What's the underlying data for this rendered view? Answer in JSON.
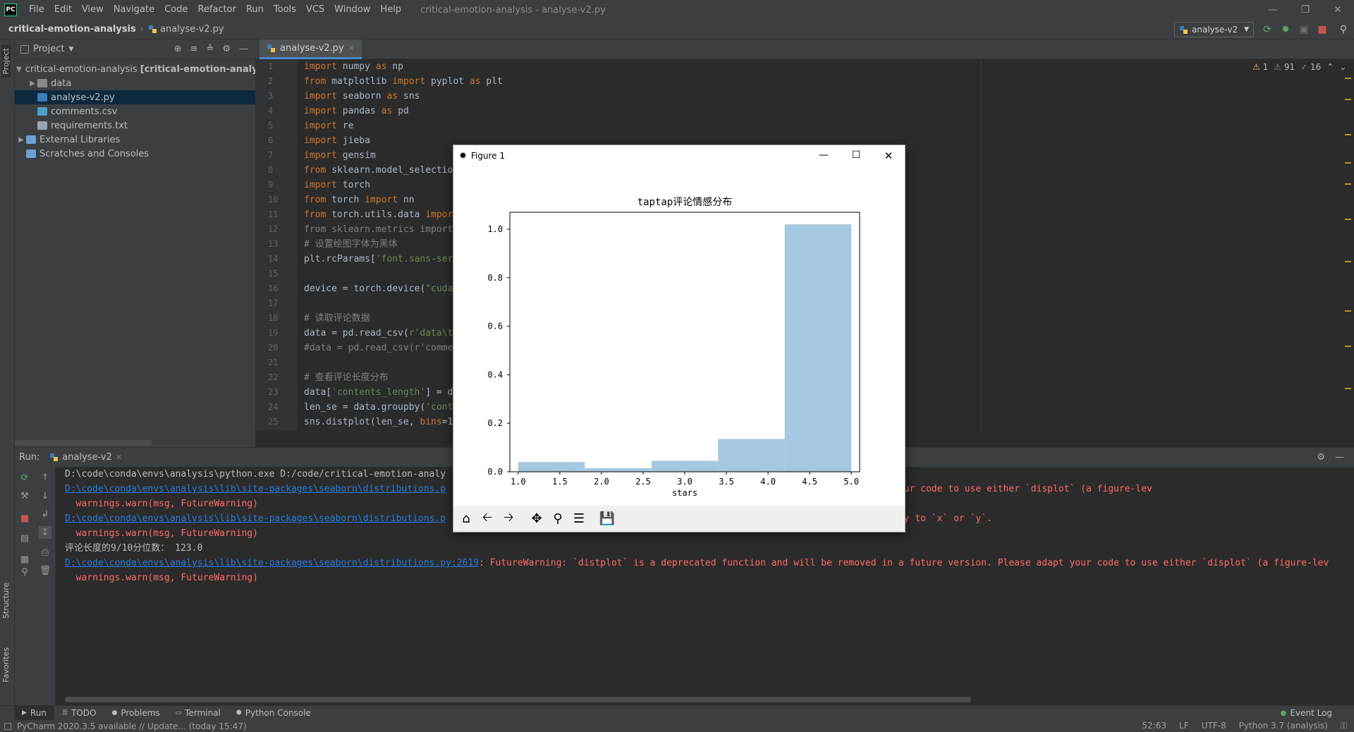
{
  "app": {
    "logo": "PC",
    "menu": [
      "File",
      "Edit",
      "View",
      "Navigate",
      "Code",
      "Refactor",
      "Run",
      "Tools",
      "VCS",
      "Window",
      "Help"
    ],
    "window_title": "critical-emotion-analysis - analyse-v2.py"
  },
  "nav": {
    "project": "critical-emotion-analysis",
    "file": "analyse-v2.py",
    "run_config": "analyse-v2"
  },
  "project_panel": {
    "title": "Project",
    "tree": [
      {
        "label": "critical-emotion-analysis",
        "suffix": "[critical-emotion-analysis]",
        "type": "root-folder"
      },
      {
        "label": "data",
        "type": "folder"
      },
      {
        "label": "analyse-v2.py",
        "type": "python",
        "selected": true
      },
      {
        "label": "comments.csv",
        "type": "csv"
      },
      {
        "label": "requirements.txt",
        "type": "text"
      },
      {
        "label": "External Libraries",
        "type": "library"
      },
      {
        "label": "Scratches and Consoles",
        "type": "scratch"
      }
    ]
  },
  "left_stripe": {
    "project": "Project",
    "structure": "Structure",
    "favorites": "Favorites"
  },
  "editor": {
    "tab_label": "analyse-v2.py",
    "inspections": {
      "warnings": "1",
      "weak_warnings": "91",
      "typos": "16"
    },
    "lines": [
      {
        "n": "1",
        "html": "<span class='kw'>import</span> numpy <span class='kw'>as</span> np"
      },
      {
        "n": "2",
        "html": "<span class='kw'>from</span> matplotlib <span class='kw'>import</span> pyplot <span class='kw'>as</span> plt"
      },
      {
        "n": "3",
        "html": "<span class='kw'>import</span> seaborn <span class='kw'>as</span> sns"
      },
      {
        "n": "4",
        "html": "<span class='kw'>import</span> pandas <span class='kw'>as</span> pd"
      },
      {
        "n": "5",
        "html": "<span class='kw'>import</span> re"
      },
      {
        "n": "6",
        "html": "<span class='kw'>import</span> jieba"
      },
      {
        "n": "7",
        "html": "<span class='kw'>import</span> gensim"
      },
      {
        "n": "8",
        "html": "<span class='kw'>from</span> sklearn.model_selectio"
      },
      {
        "n": "9",
        "html": "<span class='kw'>import</span> torch"
      },
      {
        "n": "10",
        "html": "<span class='kw'>from</span> torch <span class='kw'>import</span> nn"
      },
      {
        "n": "11",
        "html": "<span class='kw'>from</span> torch.utils.data <span class='kw'>impor</span>"
      },
      {
        "n": "12",
        "html": "<span class='cm'>from sklearn.metrics import</span>"
      },
      {
        "n": "13",
        "html": "<span class='cm'># 设置绘图字体为黑体</span>"
      },
      {
        "n": "14",
        "html": "plt.rcParams[<span class='str'>'font.sans-ser</span>"
      },
      {
        "n": "15",
        "html": ""
      },
      {
        "n": "16",
        "html": "device = torch.device(<span class='str'>\"cuda</span>"
      },
      {
        "n": "17",
        "html": ""
      },
      {
        "n": "18",
        "html": "<span class='cm'># 读取评论数据</span>"
      },
      {
        "n": "19",
        "html": "data = pd.read_csv(<span class='str'>r'data\\t</span>"
      },
      {
        "n": "20",
        "html": "<span class='cm'>#data = pd.read_csv(r'comme</span>"
      },
      {
        "n": "21",
        "html": ""
      },
      {
        "n": "22",
        "html": "<span class='cm'># 查看评论长度分布</span>"
      },
      {
        "n": "23",
        "html": "data[<span class='str'>'contents_length'</span>] = d"
      },
      {
        "n": "24",
        "html": "len_se = data.groupby(<span class='str'>'cont</span>"
      },
      {
        "n": "25",
        "html": "sns.distplot(len_se, <span class='kw'>bins</span>=1"
      }
    ]
  },
  "run_panel": {
    "label": "Run:",
    "tab": "analyse-v2",
    "console": [
      {
        "parts": [
          {
            "t": "D:\\code\\conda\\envs\\analysis\\python.exe D:/code/critical-emotion-analy",
            "c": ""
          }
        ]
      },
      {
        "parts": [
          {
            "t": "D:\\code\\conda\\envs\\analysis\\lib\\site-packages\\seaborn\\distributions.p",
            "c": "link"
          },
          {
            "t": "                                                n a future version. Please adapt your code to use either `displot` (a figure-lev",
            "c": "err"
          }
        ]
      },
      {
        "parts": [
          {
            "t": "  warnings.warn(msg, FutureWarning)",
            "c": "err"
          }
        ]
      },
      {
        "parts": [
          {
            "t": "D:\\code\\conda\\envs\\analysis\\lib\\site-packages\\seaborn\\distributions.p",
            "c": "link"
          },
          {
            "t": "                                                . Instead, assign variables directly to `x` or `y`.",
            "c": "err"
          }
        ]
      },
      {
        "parts": [
          {
            "t": "  warnings.warn(msg, FutureWarning)",
            "c": "err"
          }
        ]
      },
      {
        "parts": [
          {
            "t": "评论长度的9/10分位数： 123.0",
            "c": ""
          }
        ]
      },
      {
        "parts": [
          {
            "t": "D:\\code\\conda\\envs\\analysis\\lib\\site-packages\\seaborn\\distributions.py:2619",
            "c": "link"
          },
          {
            "t": ": FutureWarning: `distplot` is a deprecated function and will be removed in a future version. Please adapt your code to use either `displot` (a figure-lev",
            "c": "err"
          }
        ]
      },
      {
        "parts": [
          {
            "t": "  warnings.warn(msg, FutureWarning)",
            "c": "err"
          }
        ]
      }
    ]
  },
  "tool_tabs": [
    "Run",
    "TODO",
    "Problems",
    "Terminal",
    "Python Console"
  ],
  "event_log": "Event Log",
  "status": {
    "message": "PyCharm 2020.3.5 available // Update... (today 15:47)",
    "position": "52:63",
    "line_sep": "LF",
    "encoding": "UTF-8",
    "interpreter": "Python 3.7 (analysis)"
  },
  "figure": {
    "window_title": "Figure 1",
    "toolbar": [
      "home-icon",
      "back-icon",
      "forward-icon",
      "pan-icon",
      "zoom-icon",
      "configure-icon",
      "save-icon"
    ]
  },
  "chart_data": {
    "type": "bar",
    "title": "taptap评论情感分布",
    "xlabel": "stars",
    "ylabel": "",
    "bins": [
      [
        1.0,
        1.8
      ],
      [
        1.8,
        2.6
      ],
      [
        2.6,
        3.4
      ],
      [
        3.4,
        4.2
      ],
      [
        4.2,
        5.0
      ]
    ],
    "values": [
      0.04,
      0.015,
      0.045,
      0.135,
      1.02
    ],
    "xlim": [
      0.9,
      5.1
    ],
    "ylim": [
      0,
      1.07
    ],
    "xticks": [
      "1.0",
      "1.5",
      "2.0",
      "2.5",
      "3.0",
      "3.5",
      "4.0",
      "4.5",
      "5.0"
    ],
    "yticks": [
      "0.0",
      "0.2",
      "0.4",
      "0.6",
      "0.8",
      "1.0"
    ],
    "color": "#a6c8e0",
    "grid": false
  }
}
